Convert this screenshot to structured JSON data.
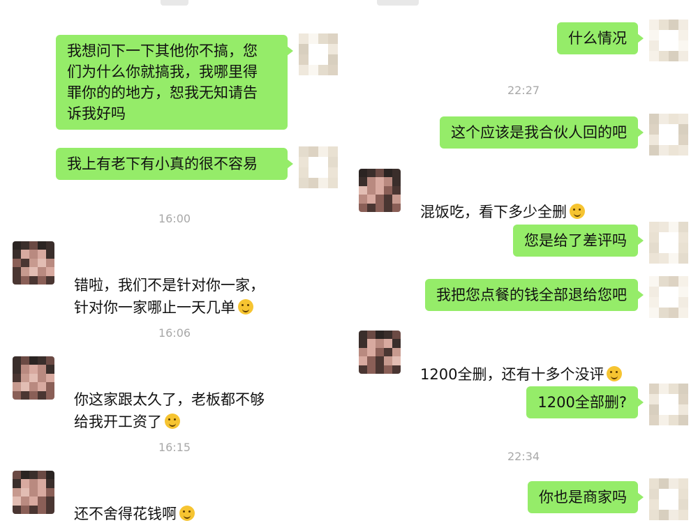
{
  "left_panel": {
    "outgoing": [
      {
        "text": "我想问下一下其他你不搞，您\n们为什么你就搞我，我哪里得\n罪你的的地方，恕我无知请告\n诉我好吗"
      },
      {
        "text": "我上有老下有小真的很不容易"
      }
    ],
    "timestamps": [
      "16:00",
      "16:06",
      "16:15"
    ],
    "incoming": [
      {
        "text": "错啦，我们不是针对你一家，\n针对你一家哪止一天几单",
        "emoji": "grin-emoji"
      },
      {
        "text": "你这家跟太久了，老板都不够\n给我开工资了",
        "emoji": "sweat-emoji"
      },
      {
        "text": "还不舍得花钱啊",
        "emoji": "sweat-emoji"
      }
    ]
  },
  "right_panel": {
    "messages": [
      {
        "side": "out",
        "text": "什么情况"
      },
      {
        "side": "out",
        "text": "这个应该是我合伙人回的吧"
      },
      {
        "side": "in",
        "text": "混饭吃，看下多少全删",
        "emoji": "smile-emoji"
      },
      {
        "side": "out",
        "text": "您是给了差评吗"
      },
      {
        "side": "out",
        "text": "我把您点餐的钱全部退给您吧"
      },
      {
        "side": "in",
        "text": "1200全删，还有十多个没评",
        "emoji": "smile-emoji"
      },
      {
        "side": "out",
        "text": "1200全部删?"
      },
      {
        "side": "out",
        "text": "你也是商家吗"
      }
    ],
    "timestamps": [
      "22:27",
      "22:34"
    ]
  },
  "colors": {
    "outgoing_bubble": "#95ec69",
    "timestamp_text": "#a8a8a8",
    "background": "#ffffff"
  }
}
